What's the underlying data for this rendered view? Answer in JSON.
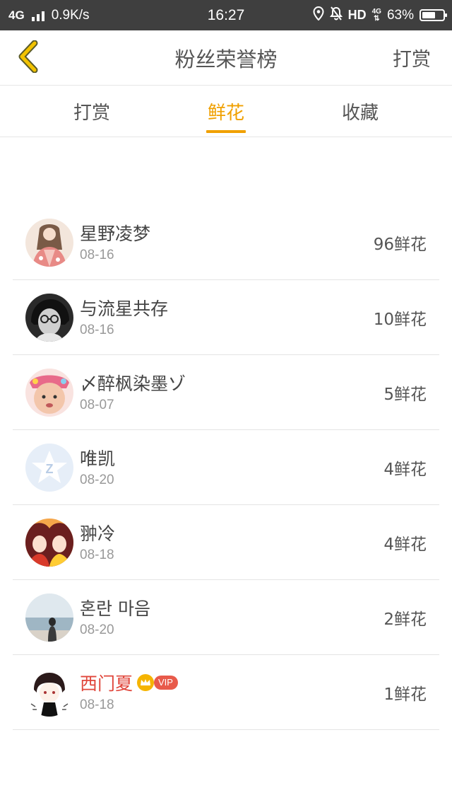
{
  "status_bar": {
    "network": "4G",
    "speed": "0.9K/s",
    "time": "16:27",
    "hd": "HD",
    "hd_top": "4G",
    "hd_bottom": "⇅",
    "battery_text": "63%",
    "battery_level": 0.63
  },
  "header": {
    "title": "粉丝荣誉榜",
    "action": "打赏"
  },
  "tabs": [
    {
      "label": "打赏",
      "active": false
    },
    {
      "label": "鲜花",
      "active": true
    },
    {
      "label": "收藏",
      "active": false
    }
  ],
  "accent_color": "#f0a000",
  "rows": [
    {
      "name": "星野凌梦",
      "date": "08-16",
      "amount": "96鲜花",
      "avatar": "girl-kimono-avatar"
    },
    {
      "name": "与流星共存",
      "date": "08-16",
      "amount": "10鲜花",
      "avatar": "glasses-person-avatar"
    },
    {
      "name": "〆醉枫染墨ゾ",
      "date": "08-07",
      "amount": "5鲜花",
      "avatar": "baby-avatar"
    },
    {
      "name": "唯凯",
      "date": "08-20",
      "amount": "4鲜花",
      "avatar": "default-star-avatar"
    },
    {
      "name": "翀冷",
      "date": "08-18",
      "amount": "4鲜花",
      "avatar": "anime-girls-avatar"
    },
    {
      "name": "혼란 마음",
      "date": "08-20",
      "amount": "2鲜花",
      "avatar": "seaside-avatar"
    },
    {
      "name": "西门夏",
      "date": "08-18",
      "amount": "1鲜花",
      "avatar": "anime-boy-avatar",
      "vip": true,
      "vip_label": "VIP"
    }
  ]
}
